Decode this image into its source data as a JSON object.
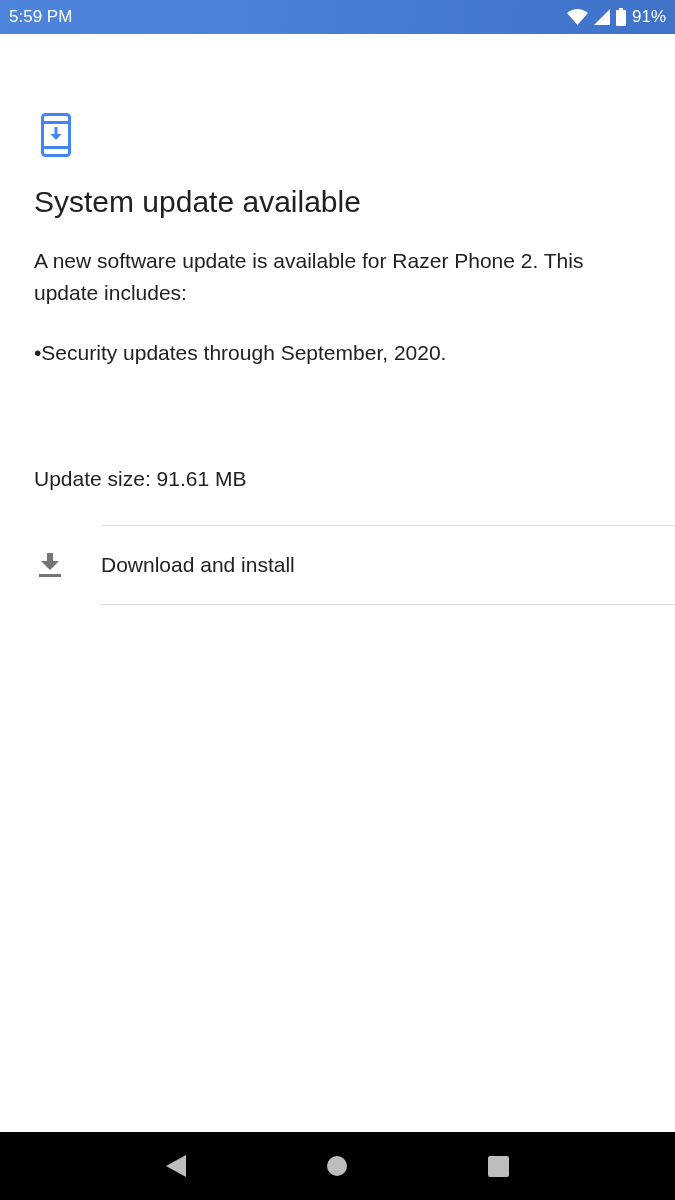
{
  "status_bar": {
    "time": "5:59 PM",
    "battery": "91%"
  },
  "title": "System update available",
  "description": "A new software update is available for Razer Phone 2. This update includes:",
  "changes": [
    "•Security updates through September, 2020."
  ],
  "update_size": "Update size: 91.61 MB",
  "action": {
    "label": "Download and install"
  }
}
